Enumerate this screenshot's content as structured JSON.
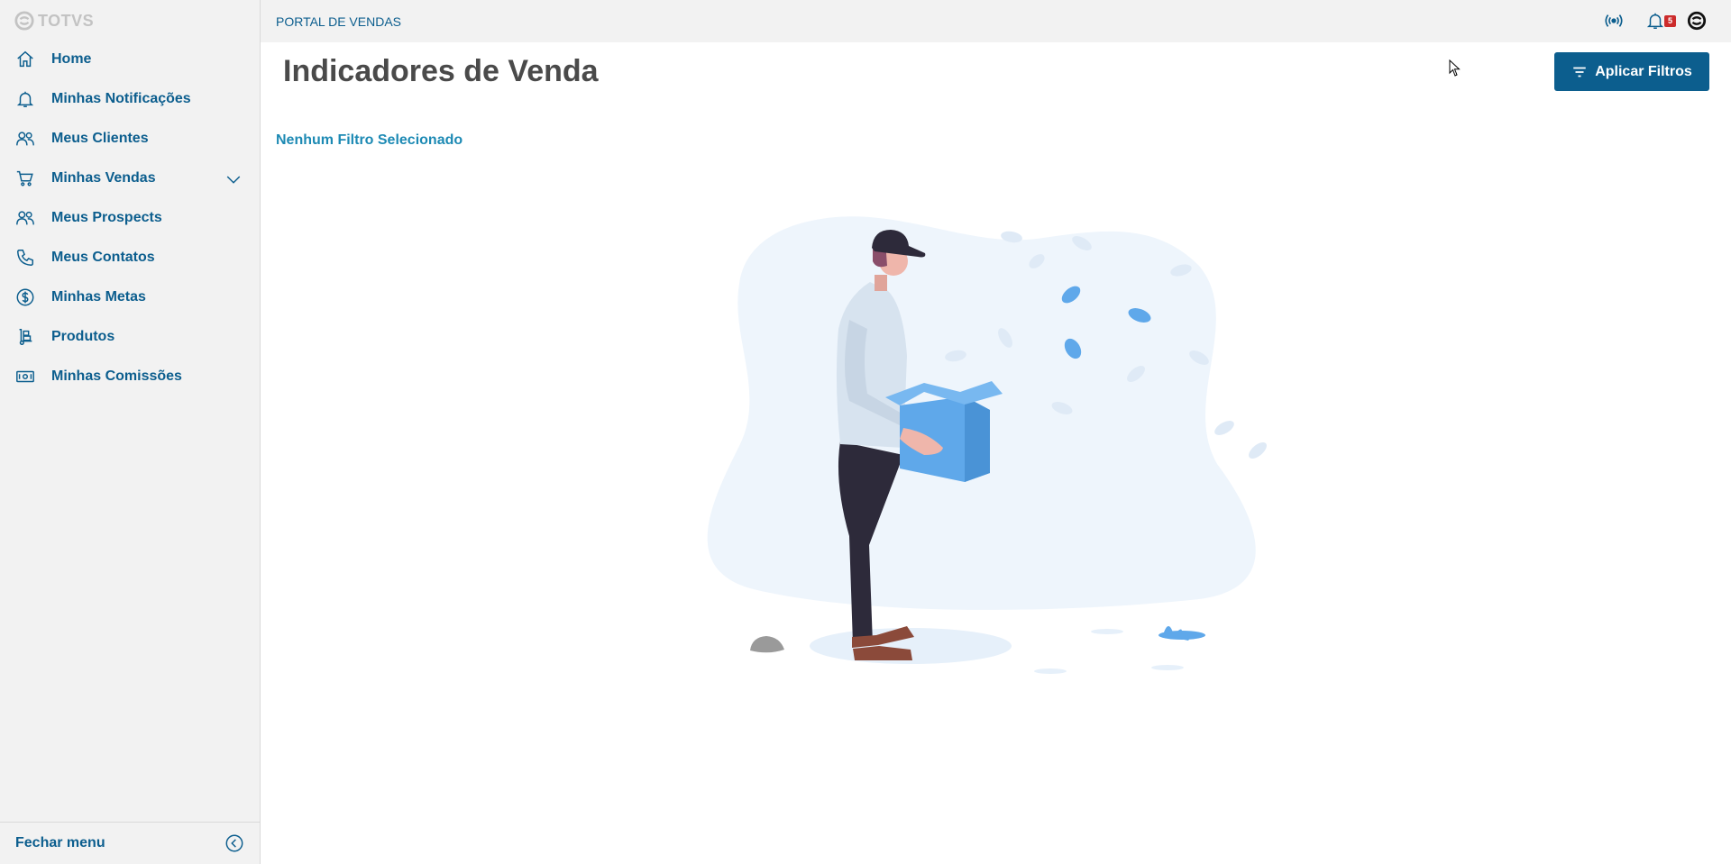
{
  "sidebar": {
    "logo_text": "TOTVS",
    "items": [
      {
        "label": "Home",
        "icon": "home-icon"
      },
      {
        "label": "Minhas Notificações",
        "icon": "bell-icon"
      },
      {
        "label": "Meus Clientes",
        "icon": "users-icon"
      },
      {
        "label": "Minhas Vendas",
        "icon": "cart-icon",
        "expandable": true
      },
      {
        "label": "Meus Prospects",
        "icon": "users-icon"
      },
      {
        "label": "Meus Contatos",
        "icon": "phone-icon"
      },
      {
        "label": "Minhas Metas",
        "icon": "dollar-circle-icon"
      },
      {
        "label": "Produtos",
        "icon": "hand-truck-icon"
      },
      {
        "label": "Minhas Comissões",
        "icon": "money-icon"
      }
    ],
    "footer_label": "Fechar menu"
  },
  "topbar": {
    "portal_label": "PORTAL DE VENDAS",
    "notification_count": "5",
    "icons": [
      "wifi-signal-icon",
      "bell-icon",
      "totvs-logo-icon"
    ]
  },
  "main": {
    "title": "Indicadores de Venda",
    "apply_button_label": "Aplicar Filtros",
    "filter_status": "Nenhum Filtro Selecionado"
  },
  "colors": {
    "primary": "#0c5e8e",
    "link": "#1d8ab4",
    "sidebar_bg": "#f2f2f2",
    "badge": "#cc2b2b"
  }
}
